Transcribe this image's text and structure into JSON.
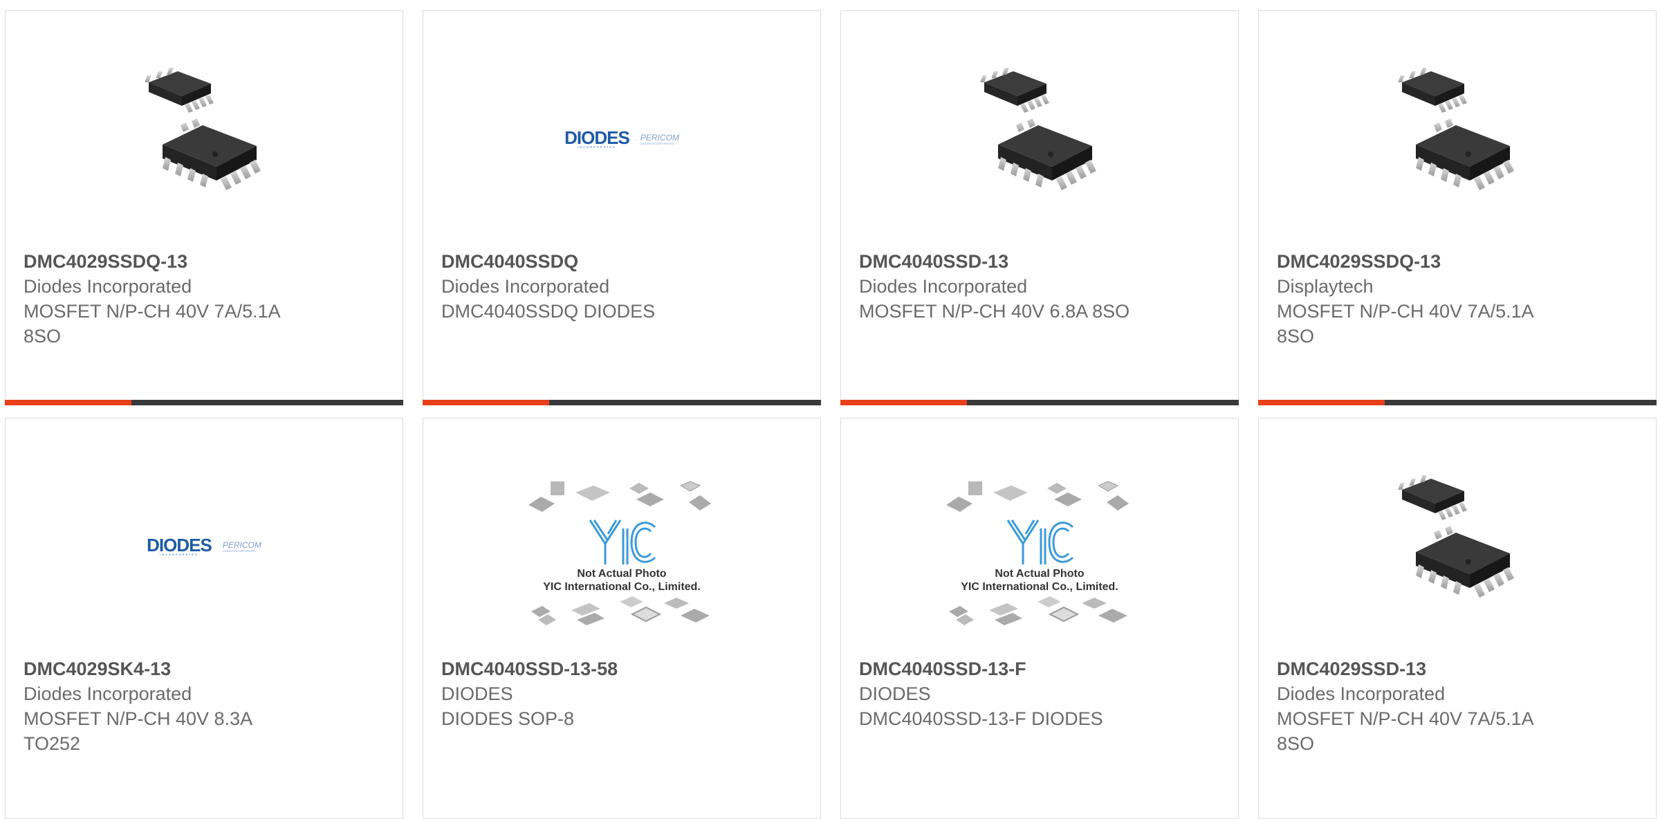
{
  "colors": {
    "accent": "#e8401a",
    "bar": "#3a3a3a",
    "diodes_blue": "#1e5aa6",
    "yic_blue": "#3a9ad9"
  },
  "products": [
    {
      "part_number": "DMC4029SSDQ-13",
      "manufacturer": "Diodes Incorporated",
      "description": "MOSFET N/P-CH 40V 7A/5.1A\n8SO",
      "image": "soic8-chip-photo"
    },
    {
      "part_number": "DMC4040SSDQ",
      "manufacturer": "Diodes Incorporated",
      "description": "DMC4040SSDQ DIODES",
      "image": "diodes-pericom-logo"
    },
    {
      "part_number": "DMC4040SSD-13",
      "manufacturer": "Diodes Incorporated",
      "description": "MOSFET N/P-CH 40V 6.8A 8SO",
      "image": "soic8-chip-photo"
    },
    {
      "part_number": "DMC4029SSDQ-13",
      "manufacturer": "Displaytech",
      "description": "MOSFET N/P-CH 40V 7A/5.1A\n8SO",
      "image": "soic8-chip-photo"
    },
    {
      "part_number": "DMC4029SK4-13",
      "manufacturer": "Diodes Incorporated",
      "description": "MOSFET N/P-CH 40V 8.3A\nTO252",
      "image": "diodes-pericom-logo"
    },
    {
      "part_number": "DMC4040SSD-13-58",
      "manufacturer": "DIODES",
      "description": "DIODES SOP-8",
      "image": "yic-placeholder"
    },
    {
      "part_number": "DMC4040SSD-13-F",
      "manufacturer": "DIODES",
      "description": "DMC4040SSD-13-F DIODES",
      "image": "yic-placeholder"
    },
    {
      "part_number": "DMC4029SSD-13",
      "manufacturer": "Diodes Incorporated",
      "description": "MOSFET N/P-CH 40V 7A/5.1A\n8SO",
      "image": "soic8-chip-photo"
    }
  ],
  "logo_text": {
    "diodes": "DIODES",
    "diodes_sub": "INCORPORATED",
    "pericom": "PERICOM",
    "pericom_sub": "DIODES INCORPORATED"
  },
  "placeholder_text": {
    "line1": "Not Actual Photo",
    "line2": "YIC International Co., Limited."
  }
}
